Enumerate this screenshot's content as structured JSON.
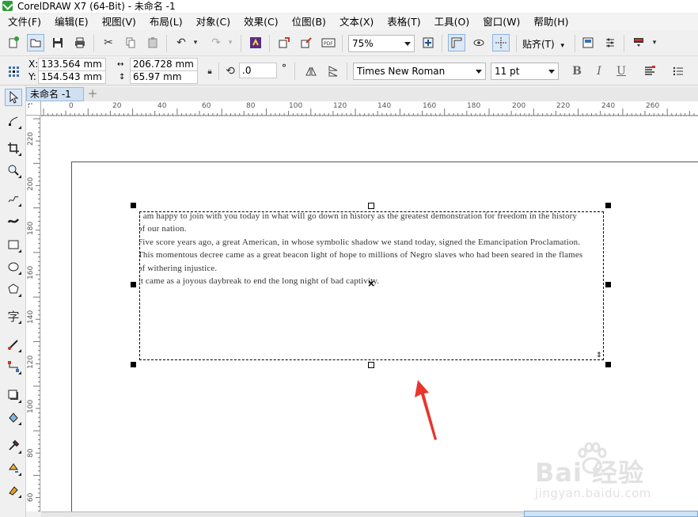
{
  "window": {
    "title": "CorelDRAW X7 (64-Bit) - 未命名 -1"
  },
  "menu": [
    "文件(F)",
    "编辑(E)",
    "视图(V)",
    "布局(L)",
    "对象(C)",
    "效果(C)",
    "位图(B)",
    "文本(X)",
    "表格(T)",
    "工具(O)",
    "窗口(W)",
    "帮助(H)"
  ],
  "toolbar": {
    "zoom": "75%",
    "snap_label": "贴齐(T)"
  },
  "property_bar": {
    "x_label": "X:",
    "x_value": "133.564 mm",
    "y_label": "Y:",
    "y_value": "154.543 mm",
    "width_value": "206.728 mm",
    "height_value": "65.97 mm",
    "angle_value": ".0",
    "degree_symbol": "°",
    "font_name": "Times New Roman",
    "font_size": "11 pt"
  },
  "document_tab": "未命名 -1",
  "ruler_h": [
    "0",
    "20",
    "40",
    "60",
    "80",
    "100",
    "120",
    "140",
    "160",
    "180",
    "200",
    "220",
    "240",
    "260"
  ],
  "ruler_v": [
    "220",
    "200",
    "180",
    "160",
    "140",
    "120",
    "100",
    "80",
    "60"
  ],
  "text_lines": [
    "I am happy to join with you today in what will go down in history as the greatest demonstration for freedom in the history",
    "of our nation.",
    "Five score years ago, a great American, in whose symbolic shadow we stand today, signed the Emancipation Proclamation.",
    "This momentous decree came as a great beacon light of hope to millions of Negro slaves who had been seared in the flames",
    "of withering injustice.",
    "It came as a joyous daybreak to end the long night of bad captivity."
  ],
  "watermark": {
    "brand": "Bai  经验",
    "url": "jingyan.baidu.com"
  },
  "colors": {
    "arrow": "#e8352b",
    "accent": "#2e9e3c",
    "selection": "#dbe8f6"
  }
}
